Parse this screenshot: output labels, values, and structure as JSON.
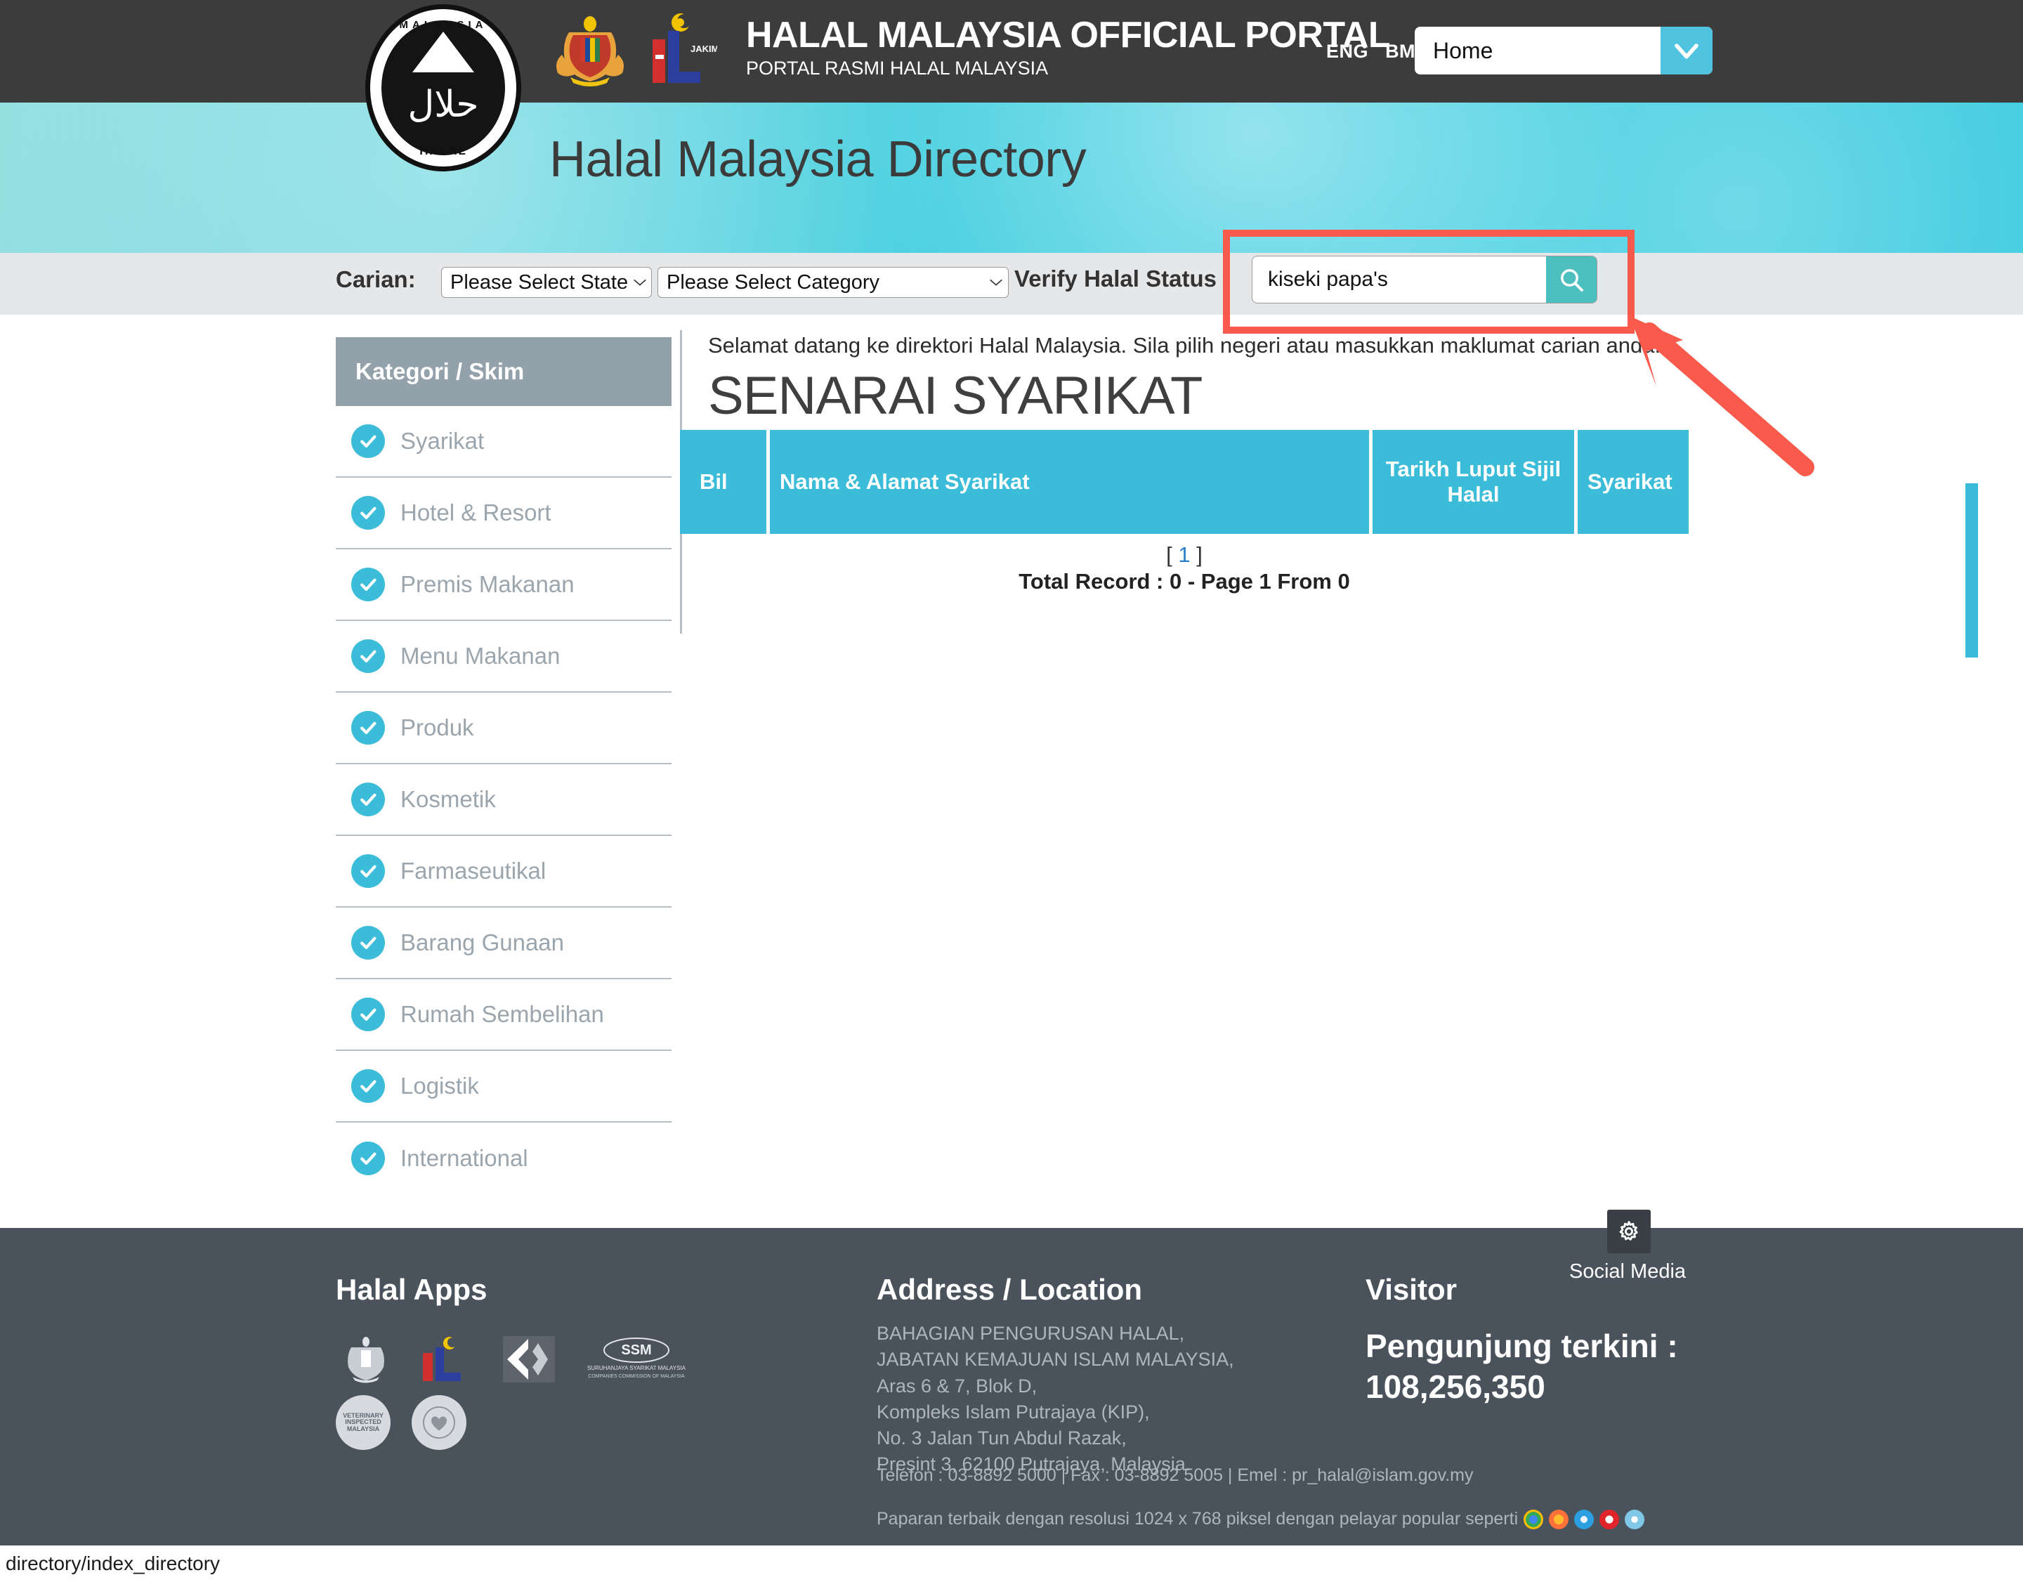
{
  "header": {
    "portal_title": "HALAL MALAYSIA OFFICIAL PORTAL",
    "portal_subtitle": "PORTAL RASMI HALAL MALAYSIA",
    "lang_eng": "ENG",
    "lang_bm": "BM",
    "nav_select_value": "Home",
    "seal_ring_text": "MALAYSIA",
    "seal_word": "HALAL",
    "seal_script": "حلال",
    "jakim_label": "JAKIM"
  },
  "banner": {
    "title": "Halal Malaysia Directory"
  },
  "search": {
    "carian_label": "Carian:",
    "state_select_value": "Please Select State",
    "category_select_value": "Please Select Category",
    "verify_label": "Verify Halal Status :",
    "query_value": "kiseki papa's",
    "query_placeholder": "",
    "search_icon": "search-icon"
  },
  "sidebar": {
    "heading": "Kategori / Skim",
    "items": [
      {
        "label": "Syarikat"
      },
      {
        "label": "Hotel & Resort"
      },
      {
        "label": "Premis Makanan"
      },
      {
        "label": "Menu Makanan"
      },
      {
        "label": "Produk"
      },
      {
        "label": "Kosmetik"
      },
      {
        "label": "Farmaseutikal"
      },
      {
        "label": "Barang Gunaan"
      },
      {
        "label": "Rumah Sembelihan"
      },
      {
        "label": "Logistik"
      },
      {
        "label": "International"
      }
    ]
  },
  "main": {
    "welcome": "Selamat datang ke direktori Halal Malaysia. Sila pilih negeri atau masukkan maklumat carian anda.",
    "heading": "SENARAI SYARIKAT",
    "table_headers": {
      "bil": "Bil",
      "nama_alamat": "Nama & Alamat Syarikat",
      "tarikh_luput": "Tarikh Luput Sijil Halal",
      "syarikat": "Syarikat"
    },
    "pagination_open": "[",
    "pagination_page": "1",
    "pagination_close": "]",
    "total_record": "Total Record : 0 - Page 1 From 0"
  },
  "footer": {
    "apps_heading": "Halal Apps",
    "address_heading": "Address / Location",
    "visitor_heading": "Visitor",
    "address_lines": "BAHAGIAN PENGURUSAN HALAL,\nJABATAN KEMAJUAN ISLAM MALAYSIA,\nAras 6 & 7, Blok D,\nKompleks Islam Putrajaya (KIP),\nNo. 3 Jalan Tun Abdul Razak,\nPresint 3, 62100 Putrajaya, Malaysia.",
    "contact_line": "Telefon : 03-8892 5000 | Fax : 03-8892 5005 | Emel : pr_halal@islam.gov.my",
    "browser_line": "Paparan terbaik dengan resolusi 1024 x 768 piksel dengan pelayar popular seperti",
    "visitor_text": "Pengunjung terkini :\n108,256,350",
    "social_label": "Social Media",
    "social_icon": "gear-icon",
    "logo_ssm_line1": "SURUHANJAYA SYARIKAT MALAYSIA",
    "logo_ssm_line2": "COMPANIES COMMISSION OF MALAYSIA",
    "logo_vet": "VETERINARY INSPECTED MALAYSIA",
    "logo_heart": "HEART"
  },
  "statusbar": {
    "url": "directory/index_directory"
  },
  "colors": {
    "accent_teal": "#3bbcd8",
    "search_btn": "#4cbfbe",
    "header_dark": "#3c3c3c",
    "footer_dark": "#4a525c",
    "annotation_red": "#fa5a4b",
    "sidebar_head": "#93a1aa",
    "link_blue": "#2a7fc9"
  }
}
